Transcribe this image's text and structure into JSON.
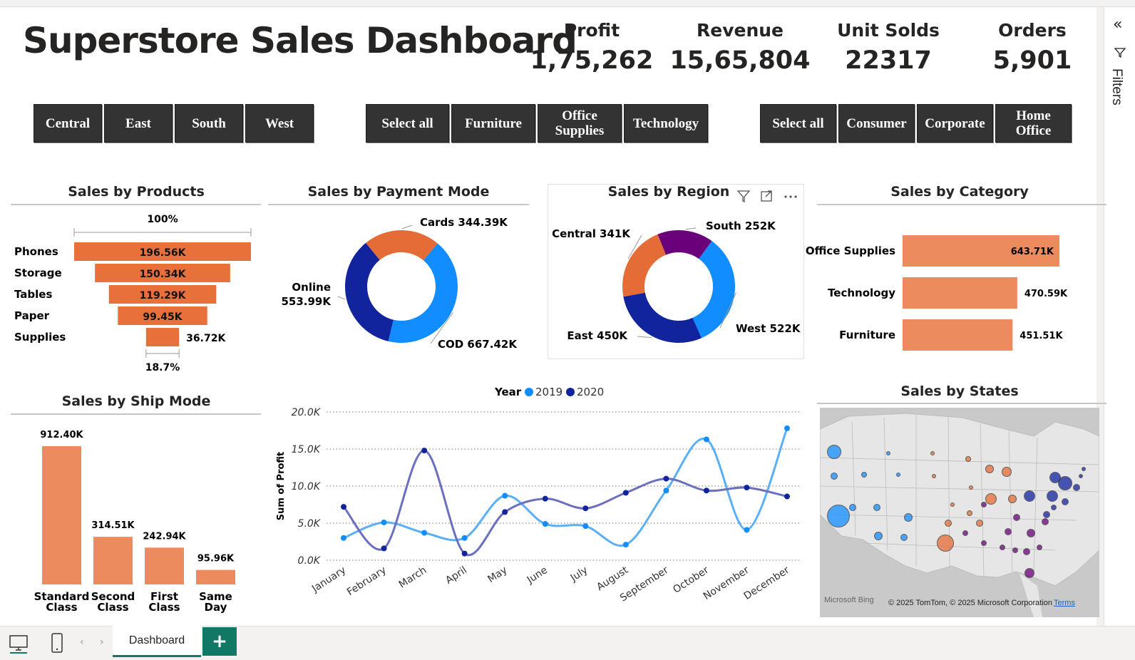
{
  "header": {
    "title": "Superstore Sales Dashboard",
    "kpis": [
      {
        "label": "Profit",
        "value": "1,75,262"
      },
      {
        "label": "Revenue",
        "value": "15,65,804"
      },
      {
        "label": "Unit Solds",
        "value": "22317"
      },
      {
        "label": "Orders",
        "value": "5,901"
      }
    ]
  },
  "slicers": {
    "region": [
      "Central",
      "East",
      "South",
      "West"
    ],
    "category": [
      "Select all",
      "Furniture",
      "Office Supplies",
      "Technology"
    ],
    "segment": [
      "Select all",
      "Consumer",
      "Corporate",
      "Home Office"
    ]
  },
  "filters_pane": {
    "label": "Filters"
  },
  "visual_titles": {
    "products": "Sales by Products",
    "payment": "Sales by Payment Mode",
    "region": "Sales by Region",
    "category": "Sales by Category",
    "ship": "Sales by Ship Mode",
    "states": "Sales by States"
  },
  "colors": {
    "orange": "#e8703a",
    "orange_light": "#ec8b5e",
    "blue_2019": "#118dff",
    "navy_2020": "#12239e",
    "purple": "#6b007b",
    "slicer_bg": "#333333",
    "accent_tab": "#117865"
  },
  "chart_data": [
    {
      "type": "bar",
      "subtype": "funnel",
      "title": "Sales by Products",
      "categories": [
        "Phones",
        "Storage",
        "Tables",
        "Paper",
        "Supplies"
      ],
      "values": [
        196.56,
        150.34,
        119.29,
        99.45,
        36.72
      ],
      "value_labels": [
        "196.56K",
        "150.34K",
        "119.29K",
        "99.45K",
        "36.72K"
      ],
      "top_label": "100%",
      "bottom_label": "18.7%"
    },
    {
      "type": "pie",
      "subtype": "donut",
      "title": "Sales by Payment Mode",
      "slices": [
        {
          "name": "COD",
          "value": 667.42,
          "label": "COD 667.42K",
          "color": "#118dff"
        },
        {
          "name": "Online",
          "value": 553.99,
          "label": "Online 553.99K",
          "color": "#12239e"
        },
        {
          "name": "Cards",
          "value": 344.39,
          "label": "Cards 344.39K",
          "color": "#e66c37"
        }
      ]
    },
    {
      "type": "pie",
      "subtype": "donut",
      "title": "Sales by Region",
      "slices": [
        {
          "name": "West",
          "value": 522,
          "label": "West 522K",
          "color": "#118dff"
        },
        {
          "name": "East",
          "value": 450,
          "label": "East 450K",
          "color": "#12239e"
        },
        {
          "name": "Central",
          "value": 341,
          "label": "Central 341K",
          "color": "#e66c37"
        },
        {
          "name": "South",
          "value": 252,
          "label": "South 252K",
          "color": "#6b007b"
        }
      ]
    },
    {
      "type": "bar",
      "orientation": "horizontal",
      "title": "Sales by Category",
      "categories": [
        "Office Supplies",
        "Technology",
        "Furniture"
      ],
      "values": [
        643.71,
        470.59,
        451.51
      ],
      "value_labels": [
        "643.71K",
        "470.59K",
        "451.51K"
      ]
    },
    {
      "type": "bar",
      "title": "Sales by Ship Mode",
      "categories": [
        "Standard Class",
        "Second Class",
        "First Class",
        "Same Day"
      ],
      "values": [
        912.4,
        314.51,
        242.94,
        95.96
      ],
      "value_labels": [
        "912.40K",
        "314.51K",
        "242.94K",
        "95.96K"
      ]
    },
    {
      "type": "line",
      "ylabel": "Sum of Profit",
      "legend_title": "Year",
      "legend_position": "top",
      "x": [
        "January",
        "February",
        "March",
        "April",
        "May",
        "June",
        "July",
        "August",
        "September",
        "October",
        "November",
        "December"
      ],
      "yticks": [
        "0.0K",
        "5.0K",
        "10.0K",
        "15.0K",
        "20.0K"
      ],
      "ylim": [
        0,
        20000
      ],
      "grid": true,
      "series": [
        {
          "name": "2019",
          "color": "#118dff",
          "values": [
            3000,
            5100,
            3700,
            3000,
            8700,
            4900,
            4600,
            2100,
            9400,
            16300,
            4100,
            17800
          ]
        },
        {
          "name": "2020",
          "color": "#12239e",
          "values": [
            7200,
            1600,
            14800,
            900,
            6500,
            8300,
            7000,
            9100,
            11000,
            9400,
            9800,
            8600
          ]
        }
      ]
    }
  ],
  "map": {
    "attribution_bing": "Microsoft Bing",
    "attribution": "© 2025 TomTom, © 2025 Microsoft Corporation",
    "terms": "Terms"
  },
  "footer": {
    "tab_label": "Dashboard",
    "add_label": "+"
  }
}
